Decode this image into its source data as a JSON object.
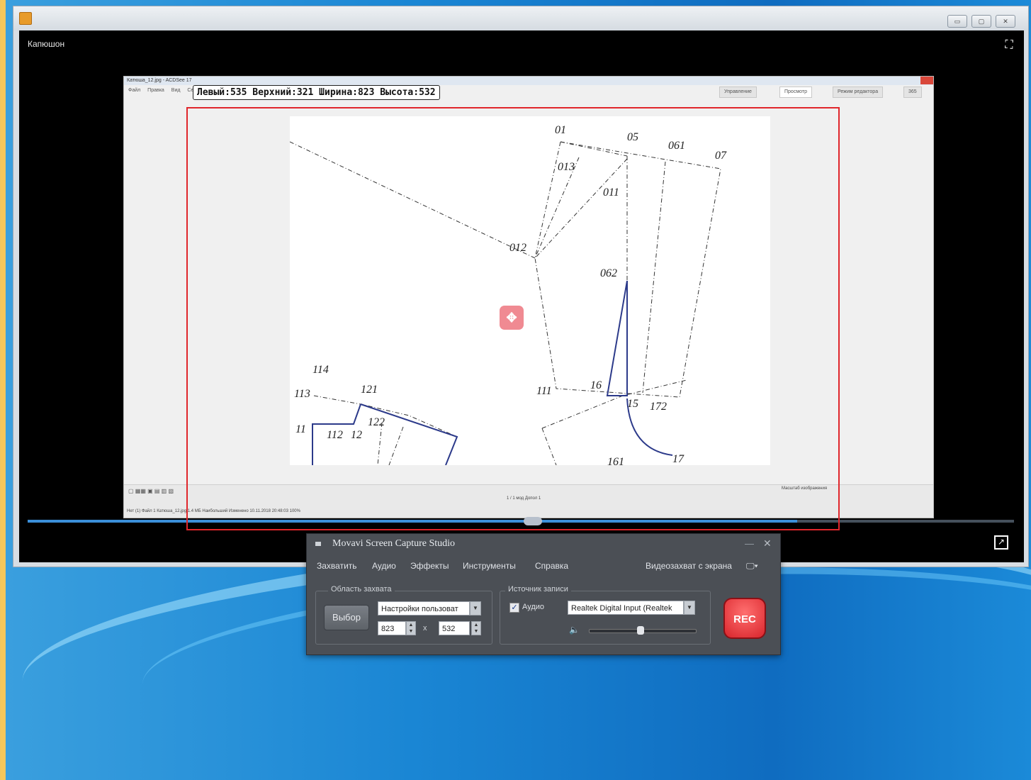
{
  "player": {
    "video_title": "Капюшон",
    "progress": 0.78
  },
  "inner_app": {
    "title": "Катюша_12.jpg - ACDSee 17",
    "menu": [
      "Файл",
      "Правка",
      "Вид",
      "Сервис"
    ],
    "tabs": [
      "Управление",
      "Просмотр",
      "Режим редактора",
      "365"
    ],
    "statusbar": "Нет (1)  Файл 1  Катюша_12.jpg  1.4 МБ  Наибольший  Изменено 10.11.2018 20:48:03  100%",
    "nav_text": "1 / 1 мод  Допол 1",
    "zoom_label": "Масштаб изображения"
  },
  "drawing_labels": [
    "01",
    "05",
    "061",
    "07",
    "013",
    "011",
    "012",
    "062",
    "114",
    "113",
    "121",
    "111",
    "16",
    "172",
    "11",
    "112",
    "12",
    "122",
    "161",
    "17",
    "15"
  ],
  "capture": {
    "dims_text": "Левый:535 Верхний:321 Ширина:823 Высота:532"
  },
  "movavi": {
    "title": "Movavi Screen Capture Studio",
    "menu": [
      "Захватить",
      "Аудио",
      "Эффекты",
      "Инструменты",
      "Справка"
    ],
    "mode_label": "Видеозахват с экрана",
    "capture_area_label": "Область захвата",
    "select_button": "Выбор",
    "preset_value": "Настройки пользоват",
    "width_value": "823",
    "height_value": "532",
    "times_sign": "x",
    "record_source_label": "Источник записи",
    "audio_checkbox_label": "Аудио",
    "audio_checked": true,
    "audio_device": "Realtek Digital Input (Realtek",
    "volume": 0.47,
    "rec_label": "REC"
  }
}
